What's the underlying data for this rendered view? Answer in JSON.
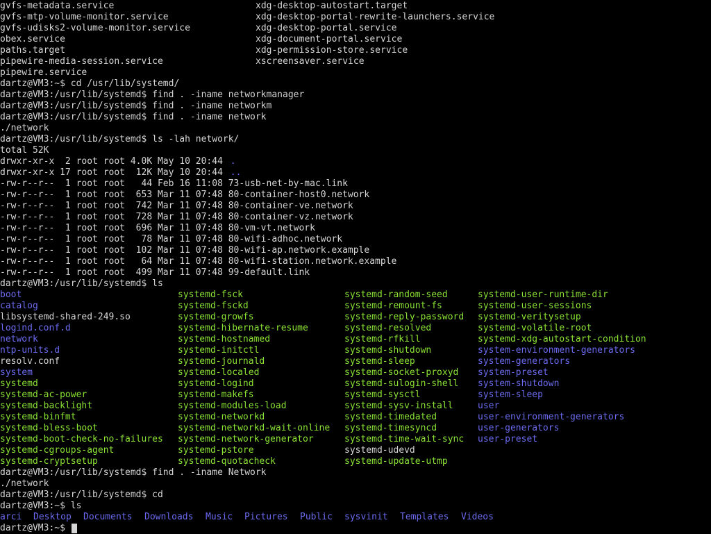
{
  "colors": {
    "background": "#000000",
    "text": "#d6d6d6",
    "directory": "#6b6bf0",
    "executable": "#8ae234",
    "symlink": "#5fd7d7"
  },
  "lines": [
    [
      [
        "gvfs-metadata.service",
        "default"
      ],
      [
        "xdg-desktop-autostart.target",
        "default"
      ]
    ],
    [
      [
        "gvfs-mtp-volume-monitor.service",
        "default"
      ],
      [
        "xdg-desktop-portal-rewrite-launchers.service",
        "default"
      ]
    ],
    [
      [
        "gvfs-udisks2-volume-monitor.service",
        "default"
      ],
      [
        "xdg-desktop-portal.service",
        "default"
      ]
    ],
    [
      [
        "obex.service",
        "default"
      ],
      [
        "xdg-document-portal.service",
        "default"
      ]
    ],
    [
      [
        "paths.target",
        "default"
      ],
      [
        "xdg-permission-store.service",
        "default"
      ]
    ],
    [
      [
        "pipewire-media-session.service",
        "default"
      ],
      [
        "xscreensaver.service",
        "default"
      ]
    ],
    [
      [
        "pipewire.service",
        "default"
      ]
    ],
    [
      [
        "dartz@VM3:~$ cd /usr/lib/systemd/",
        "default"
      ]
    ],
    [
      [
        "dartz@VM3:/usr/lib/systemd$ find . -iname networkmanager",
        "default"
      ]
    ],
    [
      [
        "dartz@VM3:/usr/lib/systemd$ find . -iname networkm",
        "default"
      ]
    ],
    [
      [
        "dartz@VM3:/usr/lib/systemd$ find . -iname network",
        "default"
      ]
    ],
    [
      [
        "./network",
        "default"
      ]
    ],
    [
      [
        "dartz@VM3:/usr/lib/systemd$ ls -lah network/",
        "default"
      ]
    ],
    [
      [
        "total 52K",
        "default"
      ]
    ],
    [
      [
        "drwxr-xr-x  2 root root 4.0K May 10 20:44 ",
        "default"
      ],
      [
        ".",
        "dir"
      ]
    ],
    [
      [
        "drwxr-xr-x 17 root root  12K May 10 20:44 ",
        "default"
      ],
      [
        "..",
        "dir"
      ]
    ],
    [
      [
        "-rw-r--r--  1 root root   44 Feb 16 11:08 73-usb-net-by-mac.link",
        "default"
      ]
    ],
    [
      [
        "-rw-r--r--  1 root root  653 Mar 11 07:48 80-container-host0.network",
        "default"
      ]
    ],
    [
      [
        "-rw-r--r--  1 root root  742 Mar 11 07:48 80-container-ve.network",
        "default"
      ]
    ],
    [
      [
        "-rw-r--r--  1 root root  728 Mar 11 07:48 80-container-vz.network",
        "default"
      ]
    ],
    [
      [
        "-rw-r--r--  1 root root  696 Mar 11 07:48 80-vm-vt.network",
        "default"
      ]
    ],
    [
      [
        "-rw-r--r--  1 root root   78 Mar 11 07:48 80-wifi-adhoc.network",
        "default"
      ]
    ],
    [
      [
        "-rw-r--r--  1 root root  102 Mar 11 07:48 80-wifi-ap.network.example",
        "default"
      ]
    ],
    [
      [
        "-rw-r--r--  1 root root   64 Mar 11 07:48 80-wifi-station.network.example",
        "default"
      ]
    ],
    [
      [
        "-rw-r--r--  1 root root  499 Mar 11 07:48 99-default.link",
        "default"
      ]
    ],
    [
      [
        "dartz@VM3:/usr/lib/systemd$ ls",
        "default"
      ]
    ],
    [
      [
        "boot",
        "dir"
      ],
      [
        "systemd-fsck",
        "exec"
      ],
      [
        "systemd-random-seed",
        "exec"
      ],
      [
        "systemd-user-runtime-dir",
        "exec"
      ]
    ],
    [
      [
        "catalog",
        "dir"
      ],
      [
        "systemd-fsckd",
        "exec"
      ],
      [
        "systemd-remount-fs",
        "exec"
      ],
      [
        "systemd-user-sessions",
        "exec"
      ]
    ],
    [
      [
        "libsystemd-shared-249.so",
        "default"
      ],
      [
        "systemd-growfs",
        "exec"
      ],
      [
        "systemd-reply-password",
        "exec"
      ],
      [
        "systemd-veritysetup",
        "exec"
      ]
    ],
    [
      [
        "logind.conf.d",
        "dir"
      ],
      [
        "systemd-hibernate-resume",
        "exec"
      ],
      [
        "systemd-resolved",
        "exec"
      ],
      [
        "systemd-volatile-root",
        "exec"
      ]
    ],
    [
      [
        "network",
        "dir"
      ],
      [
        "systemd-hostnamed",
        "exec"
      ],
      [
        "systemd-rfkill",
        "exec"
      ],
      [
        "systemd-xdg-autostart-condition",
        "exec"
      ]
    ],
    [
      [
        "ntp-units.d",
        "dir"
      ],
      [
        "systemd-initctl",
        "exec"
      ],
      [
        "systemd-shutdown",
        "exec"
      ],
      [
        "system-environment-generators",
        "dir"
      ]
    ],
    [
      [
        "resolv.conf",
        "default"
      ],
      [
        "systemd-journald",
        "exec"
      ],
      [
        "systemd-sleep",
        "exec"
      ],
      [
        "system-generators",
        "dir"
      ]
    ],
    [
      [
        "system",
        "dir"
      ],
      [
        "systemd-localed",
        "exec"
      ],
      [
        "systemd-socket-proxyd",
        "exec"
      ],
      [
        "system-preset",
        "dir"
      ]
    ],
    [
      [
        "systemd",
        "exec"
      ],
      [
        "systemd-logind",
        "exec"
      ],
      [
        "systemd-sulogin-shell",
        "exec"
      ],
      [
        "system-shutdown",
        "dir"
      ]
    ],
    [
      [
        "systemd-ac-power",
        "exec"
      ],
      [
        "systemd-makefs",
        "exec"
      ],
      [
        "systemd-sysctl",
        "exec"
      ],
      [
        "system-sleep",
        "dir"
      ]
    ],
    [
      [
        "systemd-backlight",
        "exec"
      ],
      [
        "systemd-modules-load",
        "exec"
      ],
      [
        "systemd-sysv-install",
        "exec"
      ],
      [
        "user",
        "dir"
      ]
    ],
    [
      [
        "systemd-binfmt",
        "exec"
      ],
      [
        "systemd-networkd",
        "exec"
      ],
      [
        "systemd-timedated",
        "exec"
      ],
      [
        "user-environment-generators",
        "dir"
      ]
    ],
    [
      [
        "systemd-bless-boot",
        "exec"
      ],
      [
        "systemd-networkd-wait-online",
        "exec"
      ],
      [
        "systemd-timesyncd",
        "exec"
      ],
      [
        "user-generators",
        "dir"
      ]
    ],
    [
      [
        "systemd-boot-check-no-failures",
        "exec"
      ],
      [
        "systemd-network-generator",
        "exec"
      ],
      [
        "systemd-time-wait-sync",
        "exec"
      ],
      [
        "user-preset",
        "dir"
      ]
    ],
    [
      [
        "systemd-cgroups-agent",
        "exec"
      ],
      [
        "systemd-pstore",
        "exec"
      ],
      [
        "systemd-udevd",
        "default"
      ]
    ],
    [
      [
        "systemd-cryptsetup",
        "exec"
      ],
      [
        "systemd-quotacheck",
        "exec"
      ],
      [
        "systemd-update-utmp",
        "exec"
      ]
    ],
    [
      [
        "dartz@VM3:/usr/lib/systemd$ find . -iname Network",
        "default"
      ]
    ],
    [
      [
        "./network",
        "default"
      ]
    ],
    [
      [
        "dartz@VM3:/usr/lib/systemd$ cd",
        "default"
      ]
    ],
    [
      [
        "dartz@VM3:~$ ls",
        "default"
      ]
    ],
    [
      [
        "arci",
        "dir"
      ],
      [
        "Desktop",
        "dir"
      ],
      [
        "Documents",
        "dir"
      ],
      [
        "Downloads",
        "dir"
      ],
      [
        "Music",
        "dir"
      ],
      [
        "Pictures",
        "dir"
      ],
      [
        "Public",
        "dir"
      ],
      [
        "sysvinit",
        "dir"
      ],
      [
        "Templates",
        "dir"
      ],
      [
        "Videos",
        "dir"
      ]
    ],
    [
      [
        "dartz@VM3:~$ ",
        "default"
      ]
    ]
  ]
}
